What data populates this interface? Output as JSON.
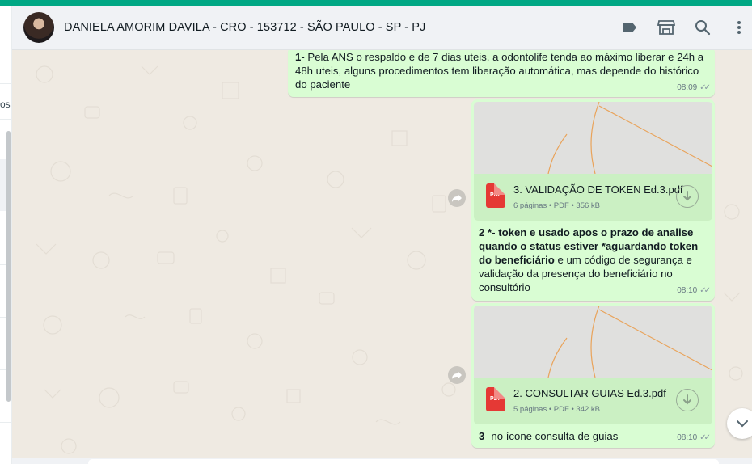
{
  "colors": {
    "brand": "#00a884",
    "outgoing_bubble": "#d9fdd3",
    "chat_bg": "#efeae2",
    "pdf_red": "#e53935"
  },
  "sidebar": {
    "fragment": "os"
  },
  "header": {
    "contact_name": "DANIELA AMORIM DAVILA - CRO - 153712 - SÃO PAULO - SP - PJ",
    "icons": [
      "label-icon",
      "catalog-icon",
      "search-icon",
      "menu-icon"
    ]
  },
  "messages": [
    {
      "type": "text",
      "number": "1",
      "text": "- Pela ANS o respaldo e de 7 dias uteis, a odontolife tenda ao máximo liberar e 24h a 48h uteis, alguns procedimentos tem liberação automática, mas depende do histórico do paciente",
      "time": "08:09"
    },
    {
      "type": "document",
      "file_name": "3. VALIDAÇÃO DE TOKEN Ed.3.pdf",
      "file_info": "6 páginas • PDF • 356 kB",
      "caption_number": "2",
      "caption_bold_1": " *- token e usado apos o prazo de analise quando o status estiver  *aguardando token do beneficiário",
      "caption_rest": " e um código de segurança e validação da presença do beneficiário no consultório",
      "time": "08:10"
    },
    {
      "type": "document",
      "file_name": "2. CONSULTAR GUIAS Ed.3.pdf",
      "file_info": "5 páginas • PDF • 342 kB",
      "caption_number": "3",
      "caption_rest": "- no ícone consulta  de guias",
      "time": "08:10"
    }
  ],
  "pdf_label": "PDF",
  "ticks": "✓✓"
}
